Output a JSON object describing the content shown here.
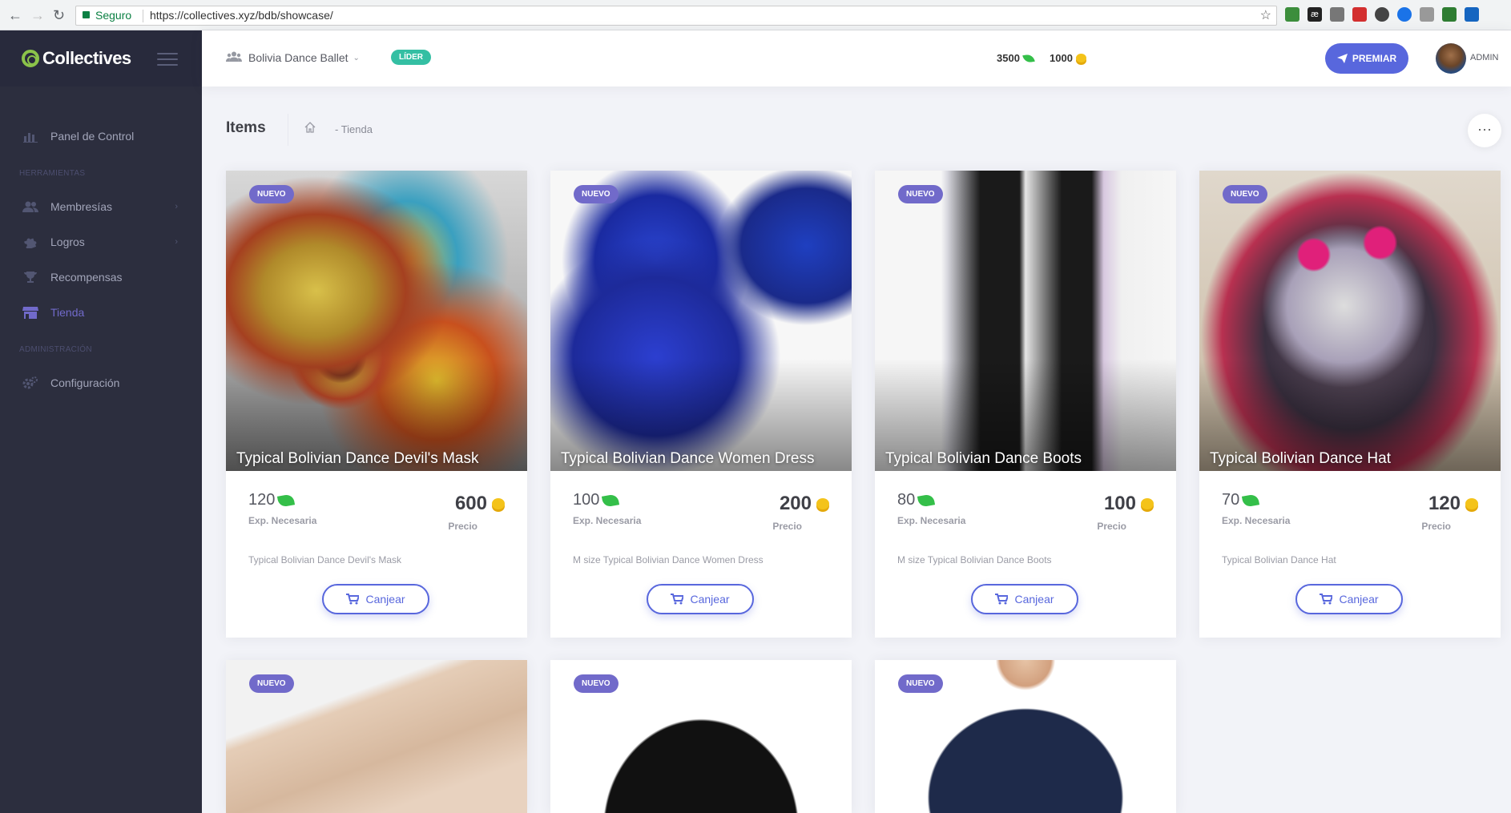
{
  "browser": {
    "secure_label": "Seguro",
    "url": "https://collectives.xyz/bdb/showcase/"
  },
  "sidebar": {
    "brand": "Collectives",
    "items": [
      {
        "label": "Panel de Control",
        "icon": "bar-chart-icon"
      },
      {
        "section": "HERRAMIENTAS"
      },
      {
        "label": "Membresías",
        "icon": "users-icon"
      },
      {
        "label": "Logros",
        "icon": "puzzle-icon"
      },
      {
        "label": "Recompensas",
        "icon": "trophy-icon"
      },
      {
        "label": "Tienda",
        "icon": "store-icon",
        "active": true
      },
      {
        "section": "ADMINISTRACIÓN"
      },
      {
        "label": "Configuración",
        "icon": "gears-icon"
      }
    ],
    "section_tools": "HERRAMIENTAS",
    "section_admin": "ADMINISTRACIÓN",
    "panel": "Panel de Control",
    "membresias": "Membresías",
    "logros": "Logros",
    "recompensas": "Recompensas",
    "tienda": "Tienda",
    "configuracion": "Configuración"
  },
  "header": {
    "org_name": "Bolivia Dance Ballet",
    "role_badge": "LÍDER",
    "exp_points": "3500",
    "coins": "1000",
    "premiar_label": "PREMIAR",
    "user_label": "ADMIN"
  },
  "subheader": {
    "title": "Items",
    "breadcrumb": "- Tienda"
  },
  "labels": {
    "exp_needed": "Exp. Necesaria",
    "price": "Precio",
    "redeem": "Canjear",
    "new_badge": "NUEVO"
  },
  "items": [
    {
      "title": "Typical Bolivian Dance Devil's Mask",
      "exp": "120",
      "price": "600",
      "description": "Typical Bolivian Dance Devil's Mask"
    },
    {
      "title": "Typical Bolivian Dance Women Dress",
      "exp": "100",
      "price": "200",
      "description": "M size Typical Bolivian Dance Women Dress"
    },
    {
      "title": "Typical Bolivian Dance Boots",
      "exp": "80",
      "price": "100",
      "description": "M size Typical Bolivian Dance Boots"
    },
    {
      "title": "Typical Bolivian Dance Hat",
      "exp": "70",
      "price": "120",
      "description": "Typical Bolivian Dance Hat"
    }
  ],
  "colors": {
    "accent": "#716aca",
    "primary_button": "#5867dd",
    "success": "#34bfa3",
    "sidebar_bg": "#2c2e3e"
  }
}
